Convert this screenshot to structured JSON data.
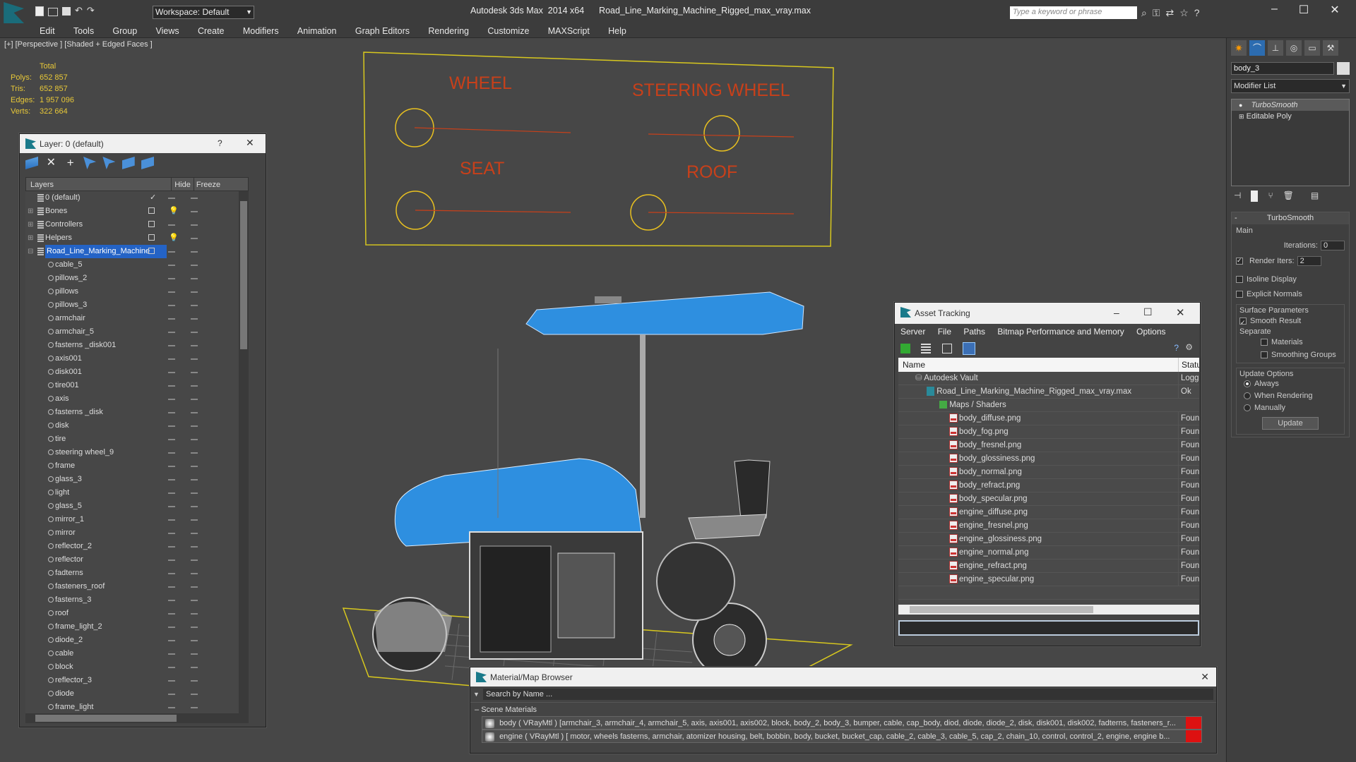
{
  "titlebar": {
    "workspace": "Workspace: Default",
    "title": "Autodesk 3ds Max  2014 x64      Road_Line_Marking_Machine_Rigged_max_vray.max",
    "search_placeholder": "Type a keyword or phrase"
  },
  "menu": [
    "Edit",
    "Tools",
    "Group",
    "Views",
    "Create",
    "Modifiers",
    "Animation",
    "Graph Editors",
    "Rendering",
    "Customize",
    "MAXScript",
    "Help"
  ],
  "viewport": {
    "label": "[+] [Perspective ] [Shaded + Edged Faces ]",
    "stats": {
      "header": "Total",
      "rows": [
        {
          "label": "Polys:",
          "value": "652 857"
        },
        {
          "label": "Tris:",
          "value": "652 857"
        },
        {
          "label": "Edges:",
          "value": "1 957 096"
        },
        {
          "label": "Verts:",
          "value": "322 664"
        }
      ]
    },
    "rig_labels": {
      "wheel": "WHEEL",
      "steering": "STEERING WHEEL",
      "seat": "SEAT",
      "roof": "ROOF"
    }
  },
  "layer_window": {
    "title": "Layer: 0 (default)",
    "help": "?",
    "columns": {
      "layers": "Layers",
      "hide": "Hide",
      "freeze": "Freeze"
    },
    "top_layers": [
      "0 (default)",
      "Bones",
      "Controllers",
      "Helpers",
      "Road_Line_Marking_Machine"
    ],
    "objects": [
      "cable_5",
      "pillows_2",
      "pillows",
      "pillows_3",
      "armchair",
      "armchair_5",
      "fasterns _disk001",
      "axis001",
      "disk001",
      "tire001",
      "axis",
      "fasterns _disk",
      "disk",
      "tire",
      "steering wheel_9",
      "frame",
      "glass_3",
      "light",
      "glass_5",
      "mirror_1",
      "mirror",
      "reflector_2",
      "reflector",
      "fadterns",
      "fasteners_roof",
      "fasterns_3",
      "roof",
      "frame_light_2",
      "diode_2",
      "cable",
      "block",
      "reflector_3",
      "diode",
      "frame_light"
    ]
  },
  "asset_tracking": {
    "title": "Asset Tracking",
    "menu": [
      "Server",
      "File",
      "Paths",
      "Bitmap Performance and Memory",
      "Options"
    ],
    "columns": {
      "name": "Name",
      "status": "Status"
    },
    "vault": {
      "name": "Autodesk Vault",
      "status": "Logged"
    },
    "file": {
      "name": "Road_Line_Marking_Machine_Rigged_max_vray.max",
      "status": "Ok"
    },
    "group": "Maps / Shaders",
    "maps": [
      "body_diffuse.png",
      "body_fog.png",
      "body_fresnel.png",
      "body_glossiness.png",
      "body_normal.png",
      "body_refract.png",
      "body_specular.png",
      "engine_diffuse.png",
      "engine_fresnel.png",
      "engine_glossiness.png",
      "engine_normal.png",
      "engine_refract.png",
      "engine_specular.png"
    ],
    "map_status": "Found"
  },
  "material_browser": {
    "title": "Material/Map Browser",
    "search_placeholder": "Search by Name ...",
    "section": "Scene Materials",
    "rows": [
      "body  ( VRayMtl ) [armchair_3, armchair_4, armchair_5, axis, axis001, axis002, block, body_2, body_3, bumper, cable, cap_body, diod, diode, diode_2, disk, disk001, disk002, fadterns, fasteners_r...",
      "engine  ( VRayMtl ) [ motor,  wheels fasterns, armchair, atomizer housing, belt, bobbin, body, bucket, bucket_cap, cable_2, cable_3, cable_5, cap_2, chain_10, control, control_2, engine, engine b..."
    ]
  },
  "command_panel": {
    "object_name": "body_3",
    "modifier_list": "Modifier List",
    "stack": [
      "TurboSmooth",
      "Editable Poly"
    ],
    "rollout": "TurboSmooth",
    "main": "Main",
    "iterations_label": "Iterations:",
    "iterations": "0",
    "render_iters_label": "Render Iters:",
    "render_iters": "2",
    "isoline": "Isoline Display",
    "explicit": "Explicit Normals",
    "surface": "Surface Parameters",
    "smooth_result": "Smooth Result",
    "separate": "Separate",
    "materials": "Materials",
    "smoothing_groups": "Smoothing Groups",
    "update_options": "Update Options",
    "always": "Always",
    "when_rendering": "When Rendering",
    "manually": "Manually",
    "update": "Update"
  },
  "colors": {
    "accent": "#1e6fd9",
    "rig": "#c8401a",
    "frame": "#d8c81e",
    "mesh": "#2e8fe0"
  }
}
